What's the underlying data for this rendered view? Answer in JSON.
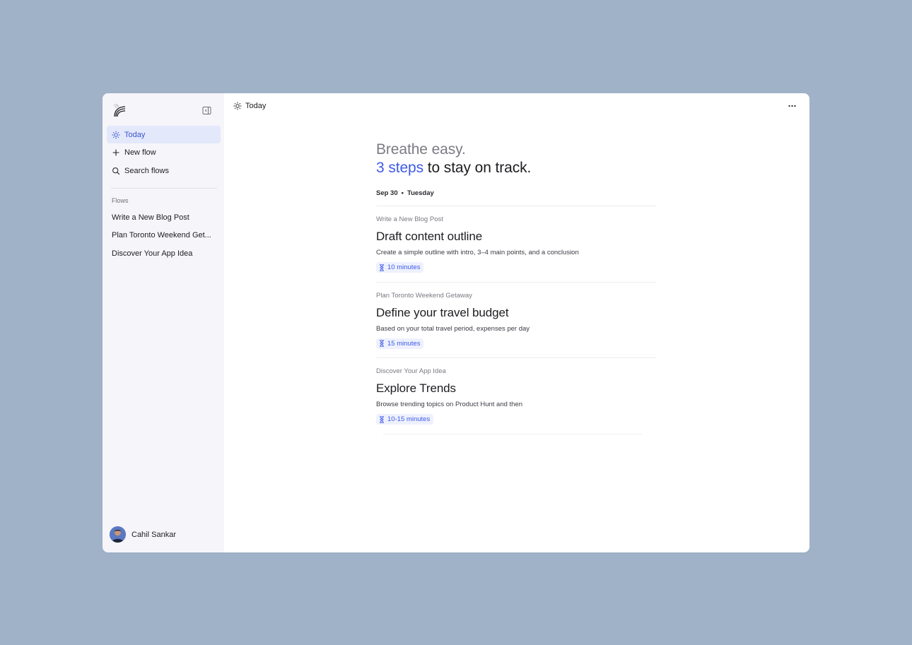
{
  "sidebar": {
    "nav": [
      {
        "label": "Today",
        "icon": "sun-icon",
        "active": true
      },
      {
        "label": "New flow",
        "icon": "plus-icon"
      },
      {
        "label": "Search flows",
        "icon": "search-icon"
      }
    ],
    "flows_label": "Flows",
    "flows": [
      "Write a New Blog Post",
      "Plan Toronto Weekend Get...",
      "Discover Your App Idea"
    ],
    "user": {
      "name": "Cahil Sankar"
    }
  },
  "topbar": {
    "title": "Today"
  },
  "main": {
    "headline_line1": "Breathe easy.",
    "headline_accent": "3 steps",
    "headline_rest": " to stay on track.",
    "date": "Sep 30",
    "weekday": "Tuesday",
    "cards": [
      {
        "flow": "Write a New Blog Post",
        "title": "Draft content outline",
        "desc": "Create a simple outline with intro, 3–4 main points, and a conclusion",
        "duration": "10 minutes"
      },
      {
        "flow": "Plan Toronto Weekend Getaway",
        "title": "Define your travel budget",
        "desc": "Based on your total travel period, expenses per day",
        "duration": "15 minutes"
      },
      {
        "flow": "Discover Your App Idea",
        "title": "Explore Trends",
        "desc": "Browse trending topics on Product Hunt and then",
        "duration": "10-15 minutes"
      }
    ]
  },
  "colors": {
    "background": "#a0b2c8",
    "sidebar": "#f6f5f9",
    "accent": "#3d5ae8",
    "active_nav": "#e3e8fb"
  }
}
